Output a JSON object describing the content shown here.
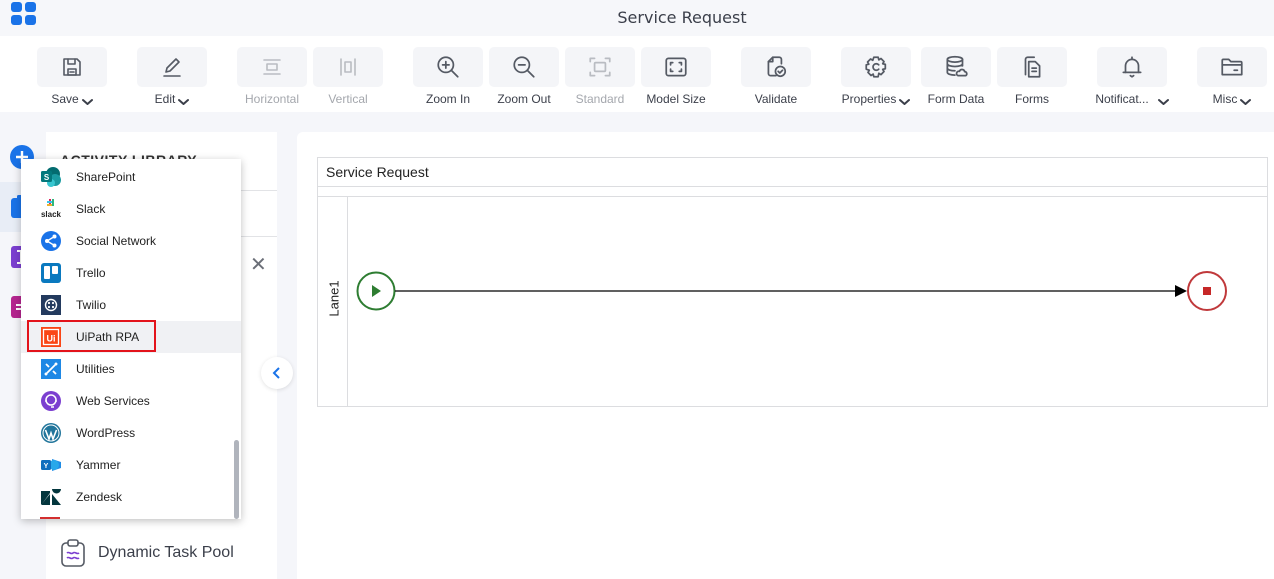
{
  "header": {
    "app_icon": "apps-grid-icon",
    "title": "Service Request"
  },
  "toolbar": {
    "items": [
      {
        "label": "Save",
        "icon": "save-icon",
        "has_dropdown": true,
        "disabled": false
      },
      {
        "label": "Edit",
        "icon": "edit-icon",
        "has_dropdown": true,
        "disabled": false
      },
      {
        "label": "Horizontal",
        "icon": "horizontal-icon",
        "has_dropdown": false,
        "disabled": true
      },
      {
        "label": "Vertical",
        "icon": "vertical-icon",
        "has_dropdown": false,
        "disabled": true
      },
      {
        "label": "Zoom In",
        "icon": "zoom-in-icon",
        "has_dropdown": false,
        "disabled": false
      },
      {
        "label": "Zoom Out",
        "icon": "zoom-out-icon",
        "has_dropdown": false,
        "disabled": false
      },
      {
        "label": "Standard",
        "icon": "standard-icon",
        "has_dropdown": false,
        "disabled": true
      },
      {
        "label": "Model Size",
        "icon": "model-size-icon",
        "has_dropdown": false,
        "disabled": false
      },
      {
        "label": "Validate",
        "icon": "validate-icon",
        "has_dropdown": false,
        "disabled": false
      },
      {
        "label": "Properties",
        "icon": "gear-icon",
        "has_dropdown": true,
        "disabled": false
      },
      {
        "label": "Form Data",
        "icon": "database-icon",
        "has_dropdown": false,
        "disabled": false
      },
      {
        "label": "Forms",
        "icon": "forms-icon",
        "has_dropdown": false,
        "disabled": false
      },
      {
        "label": "Notificat...",
        "icon": "bell-icon",
        "has_dropdown": true,
        "disabled": false
      },
      {
        "label": "Misc",
        "icon": "folder-icon",
        "has_dropdown": true,
        "disabled": false
      }
    ]
  },
  "library": {
    "title": "ACTIVITY LIBRARY",
    "close_icon": "close-icon",
    "visible_item": "Dynamic Task Pool"
  },
  "dropdown": {
    "highlighted": "UiPath RPA",
    "items": [
      {
        "label": "SharePoint",
        "icon": "sharepoint-icon"
      },
      {
        "label": "Slack",
        "icon": "slack-icon"
      },
      {
        "label": "Social Network",
        "icon": "share-icon"
      },
      {
        "label": "Trello",
        "icon": "trello-icon"
      },
      {
        "label": "Twilio",
        "icon": "twilio-icon"
      },
      {
        "label": "UiPath RPA",
        "icon": "uipath-icon"
      },
      {
        "label": "Utilities",
        "icon": "utilities-icon"
      },
      {
        "label": "Web Services",
        "icon": "web-services-icon"
      },
      {
        "label": "WordPress",
        "icon": "wordpress-icon"
      },
      {
        "label": "Yammer",
        "icon": "yammer-icon"
      },
      {
        "label": "Zendesk",
        "icon": "zendesk-icon"
      }
    ]
  },
  "canvas": {
    "pool_title": "Service Request",
    "lane_label": "Lane1",
    "start_event": "start-event",
    "end_event": "end-event"
  },
  "colors": {
    "accent": "#1a73e8",
    "start_event": "#2e7d32",
    "end_event": "#c62828",
    "highlight_border": "#e3131b"
  }
}
